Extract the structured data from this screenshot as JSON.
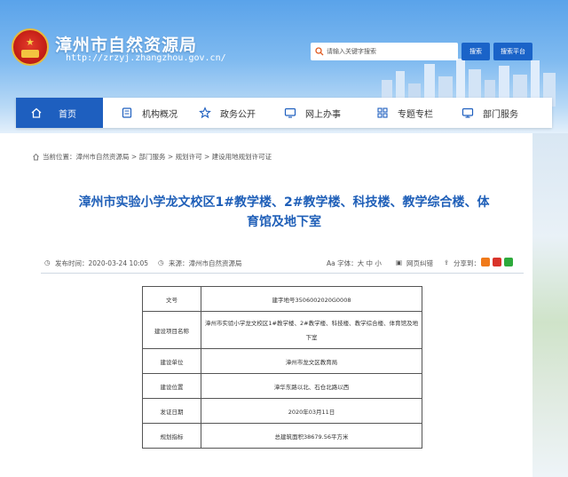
{
  "header": {
    "site_title": "漳州市自然资源局",
    "site_url": "http://zrzyj.zhangzhou.gov.cn/",
    "search_placeholder": "请输入关键字搜索",
    "search_button": "搜索",
    "platform_button": "搜索平台"
  },
  "nav": {
    "items": [
      {
        "label": "首页",
        "icon": "home-icon"
      },
      {
        "label": "机构概况",
        "icon": "org-icon"
      },
      {
        "label": "政务公开",
        "icon": "star-icon"
      },
      {
        "label": "网上办事",
        "icon": "monitor-icon"
      },
      {
        "label": "专题专栏",
        "icon": "grid-icon"
      },
      {
        "label": "部门服务",
        "icon": "screen-icon"
      }
    ]
  },
  "breadcrumb": "当前位置：漳州市自然资源局 > 部门服务 > 规划许可 > 建设用地规划许可证",
  "article": {
    "title_line1": "漳州市实验小学龙文校区1#教学楼、2#教学楼、科技楼、教学综合楼、体",
    "title_line2": "育馆及地下室",
    "publish_time": "发布时间：2020-03-24 10:05",
    "source": "来源：漳州市自然资源局",
    "font_size": "Aa 字体：大 中 小",
    "error_correct": "网页纠错",
    "share": "分享到："
  },
  "table": [
    {
      "key": "文号",
      "value": "建字地号3506002020G0008"
    },
    {
      "key": "建设项目名称",
      "value": "漳州市实验小学龙文校区1#教学楼、2#教学楼、科技楼、教学综合楼、体育馆及地下室"
    },
    {
      "key": "建设单位",
      "value": "漳州市龙文区教育局"
    },
    {
      "key": "建设位置",
      "value": "漳华东路以北、石仓北路以西"
    },
    {
      "key": "发证日期",
      "value": "2020年03月11日"
    },
    {
      "key": "规划指标",
      "value": "总建筑面积38679.56平方米"
    }
  ],
  "colors": {
    "nav_active": "#1e5fbf",
    "title_blue": "#1f5fb8",
    "share_orange": "#f07a1a",
    "share_red": "#d9342b",
    "share_green": "#2eaa3c"
  }
}
